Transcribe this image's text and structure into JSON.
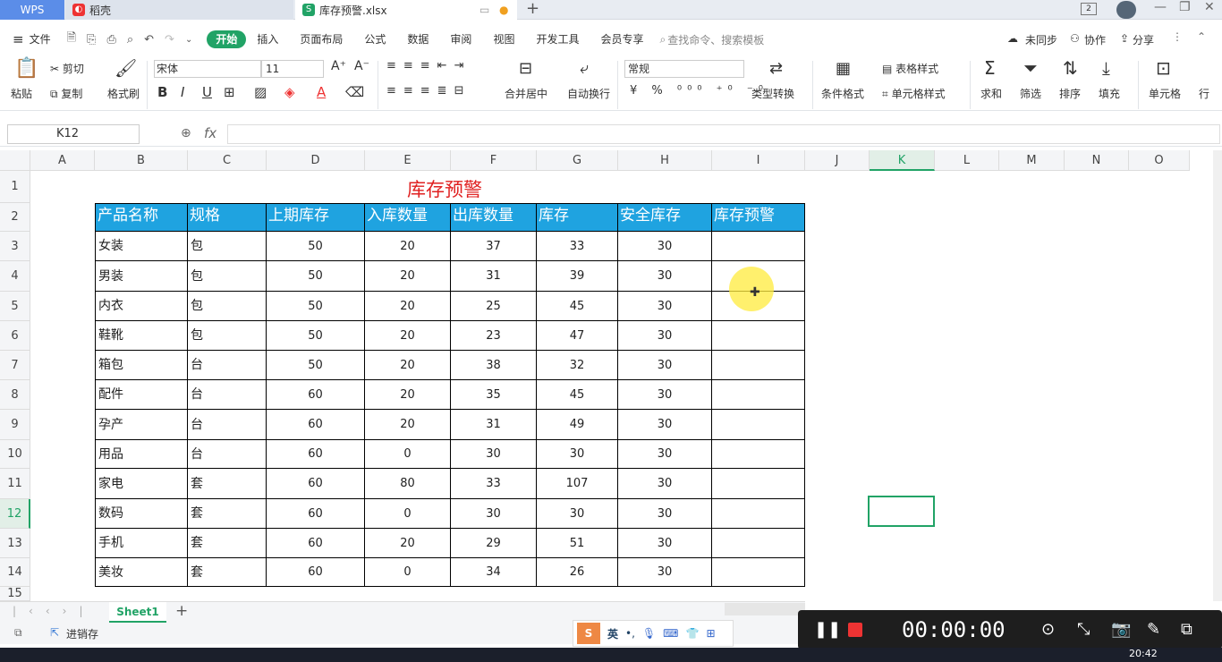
{
  "tabs": {
    "wps": "WPS",
    "daoke": "稻壳",
    "file": "库存预警.xlsx",
    "badge_num": "2"
  },
  "menu": {
    "file": "文件",
    "items": [
      "开始",
      "插入",
      "页面布局",
      "公式",
      "数据",
      "审阅",
      "视图",
      "开发工具",
      "会员专享"
    ],
    "search": "查找命令、搜索模板",
    "sync": "未同步",
    "collab": "协作",
    "share": "分享"
  },
  "ribbon": {
    "paste": "粘贴",
    "cut": "剪切",
    "copy": "复制",
    "format_painter": "格式刷",
    "font": "宋体",
    "size": "11",
    "merge": "合并居中",
    "wrap": "自动换行",
    "numfmt": "常规",
    "convert": "类型转换",
    "cond_format": "条件格式",
    "table_style": "表格样式",
    "cell_style": "单元格样式",
    "sum": "求和",
    "filter": "筛选",
    "sort": "排序",
    "fill": "填充",
    "cell": "单元格",
    "row_col": "行"
  },
  "formula": {
    "cellref": "K12",
    "fx": "fx",
    "value": ""
  },
  "sheet": {
    "columns": [
      "A",
      "B",
      "C",
      "D",
      "E",
      "F",
      "G",
      "H",
      "I",
      "J",
      "K",
      "L",
      "M",
      "N",
      "O"
    ],
    "rows": [
      "1",
      "2",
      "3",
      "4",
      "5",
      "6",
      "7",
      "8",
      "9",
      "10",
      "11",
      "12",
      "13",
      "14",
      "15"
    ],
    "title": "库存预警",
    "headers": [
      "产品名称",
      "规格",
      "上期库存",
      "入库数量",
      "出库数量",
      "库存",
      "安全库存",
      "库存预警"
    ],
    "data": [
      [
        "女装",
        "包",
        "50",
        "20",
        "37",
        "33",
        "30",
        ""
      ],
      [
        "男装",
        "包",
        "50",
        "20",
        "31",
        "39",
        "30",
        ""
      ],
      [
        "内衣",
        "包",
        "50",
        "20",
        "25",
        "45",
        "30",
        ""
      ],
      [
        "鞋靴",
        "包",
        "50",
        "20",
        "23",
        "47",
        "30",
        ""
      ],
      [
        "箱包",
        "台",
        "50",
        "20",
        "38",
        "32",
        "30",
        ""
      ],
      [
        "配件",
        "台",
        "60",
        "20",
        "35",
        "45",
        "30",
        ""
      ],
      [
        "孕产",
        "台",
        "60",
        "20",
        "31",
        "49",
        "30",
        ""
      ],
      [
        "用品",
        "台",
        "60",
        "0",
        "30",
        "30",
        "30",
        ""
      ],
      [
        "家电",
        "套",
        "60",
        "80",
        "33",
        "107",
        "30",
        ""
      ],
      [
        "数码",
        "套",
        "60",
        "0",
        "30",
        "30",
        "30",
        ""
      ],
      [
        "手机",
        "套",
        "60",
        "20",
        "29",
        "51",
        "30",
        ""
      ],
      [
        "美妆",
        "套",
        "60",
        "0",
        "34",
        "26",
        "30",
        ""
      ]
    ]
  },
  "sheets": {
    "active": "Sheet1",
    "add": "+"
  },
  "status": {
    "undo": "进销存"
  },
  "ime": {
    "mode": "英"
  },
  "recorder": {
    "time": "00:00:00"
  },
  "taskbar": {
    "clock": "20:42"
  },
  "colors": {
    "header_bg": "#1fa3e0",
    "title": "#e02020",
    "accent": "#21a366"
  }
}
